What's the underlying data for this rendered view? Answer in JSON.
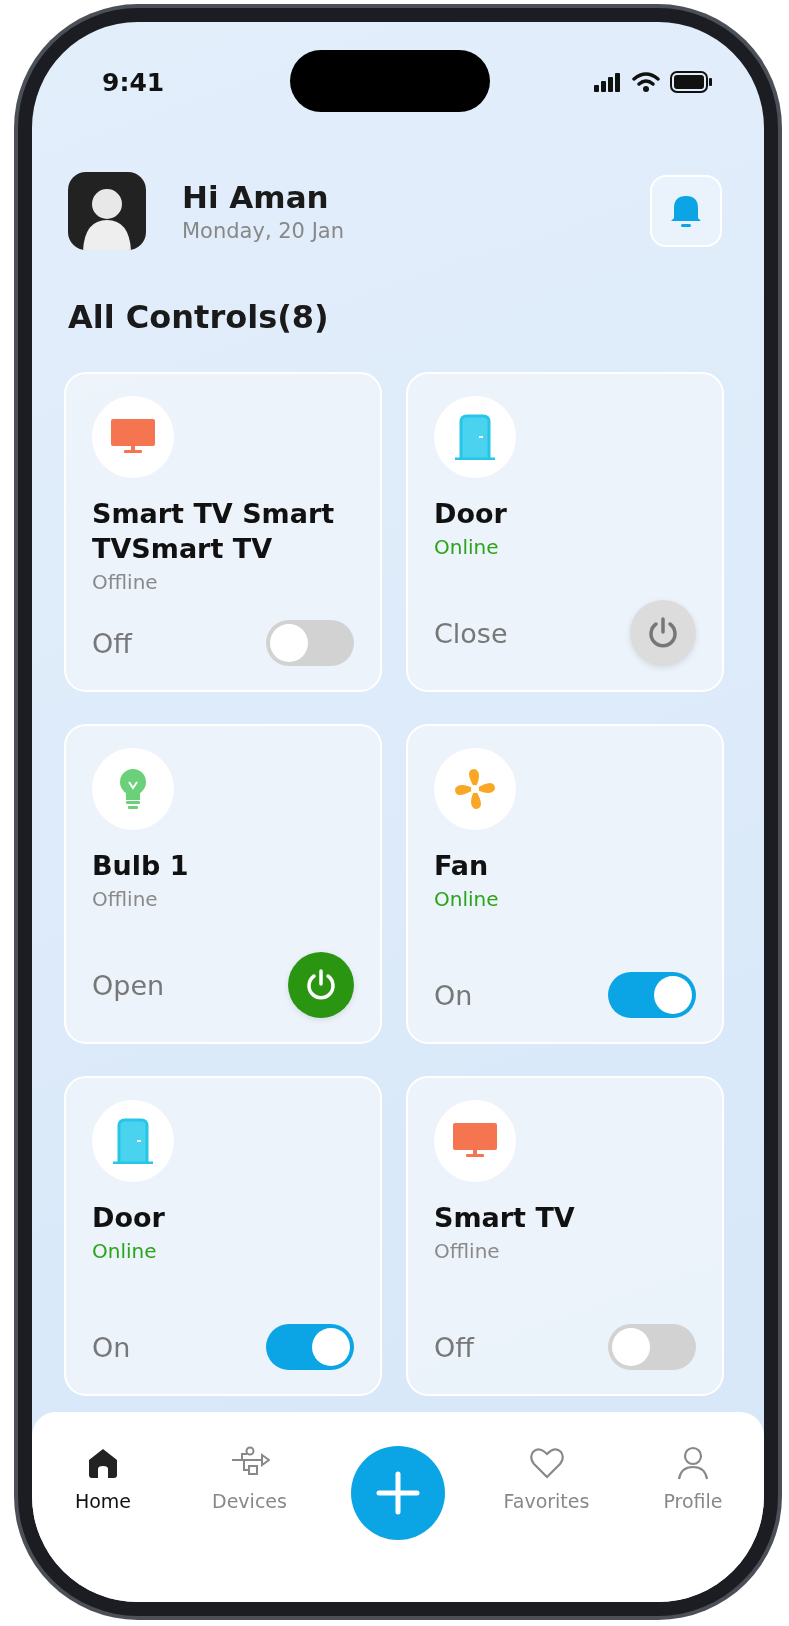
{
  "status_bar": {
    "time": "9:41"
  },
  "header": {
    "greeting": "Hi Aman",
    "date": "Monday, 20 Jan"
  },
  "section_title": "All Controls(8)",
  "devices": [
    {
      "name": "Smart TV Smart TVSmart TV",
      "kind": "tv",
      "status": "Offline",
      "online": false,
      "state_label": "Off",
      "control": {
        "kind": "toggle",
        "on": false
      }
    },
    {
      "name": "Door",
      "kind": "door",
      "status": "Online",
      "online": true,
      "state_label": "Close",
      "control": {
        "kind": "power",
        "on": false
      }
    },
    {
      "name": "Bulb 1",
      "kind": "bulb",
      "status": "Offline",
      "online": false,
      "state_label": "Open",
      "control": {
        "kind": "power",
        "on": true
      }
    },
    {
      "name": "Fan",
      "kind": "fan",
      "status": "Online",
      "online": true,
      "state_label": "On",
      "control": {
        "kind": "toggle",
        "on": true
      }
    },
    {
      "name": "Door",
      "kind": "door",
      "status": "Online",
      "online": true,
      "state_label": "On",
      "control": {
        "kind": "toggle",
        "on": true
      }
    },
    {
      "name": "Smart TV",
      "kind": "tv",
      "status": "Offline",
      "online": false,
      "state_label": "Off",
      "control": {
        "kind": "toggle",
        "on": false
      }
    }
  ],
  "nav": [
    {
      "label": "Home",
      "kind": "home",
      "selected": true
    },
    {
      "label": "Devices",
      "kind": "devices",
      "selected": false
    },
    {
      "kind": "add"
    },
    {
      "label": "Favorites",
      "kind": "favorites",
      "selected": false
    },
    {
      "label": "Profile",
      "kind": "profile",
      "selected": false
    }
  ]
}
